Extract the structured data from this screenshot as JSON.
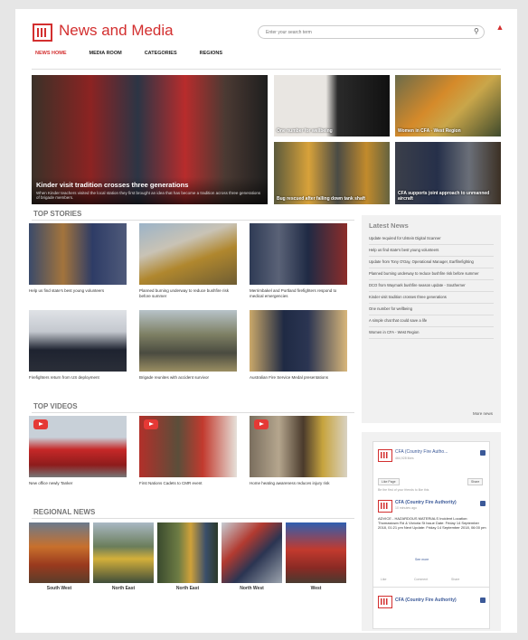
{
  "header": {
    "site_title": "News and Media",
    "search_placeholder": "Enter your search term",
    "nav": [
      "NEWS HOME",
      "MEDIA ROOM",
      "CATEGORIES",
      "REGIONS"
    ]
  },
  "hero": {
    "title": "Kinder visit tradition crosses three generations",
    "description": "When Kinder teachers visited the local station they first brought an idea that has become a tradition across three generations of brigade members."
  },
  "feature_tiles": [
    "One number for wellbeing",
    "Women in CFA - West Region",
    "Bug rescued after falling down tank shaft",
    "CFA supports joint approach to unmanned aircraft"
  ],
  "top_stories": {
    "title": "TOP STORIES",
    "items": [
      "Help us find state's best young volunteers",
      "Planned burning underway to reduce bushfire risk before summer",
      "Merrimbakel and Portland firefighters respond to medical emergencies",
      "Firefighters return from US deployment",
      "Brigade reunites with accident survivor",
      "Australian Fire Service Medal presentations"
    ]
  },
  "latest_news": {
    "title": "Latest News",
    "items": [
      "Update required for Ulstein Digital Scanner",
      "Help us find state's best young volunteers",
      "Update from Tony O'Day, Operational Manager, Earlfirefighting",
      "Planned burning underway to reduce bushfire risk before summer",
      "DCO from Waymark bushfire season update - Southerner",
      "Kinder visit tradition crosses three generations",
      "One number for wellbeing",
      "A simple chat that could save a life",
      "Women in CFA - West Region"
    ],
    "more": "More news"
  },
  "top_videos": {
    "title": "TOP VIDEOS",
    "items": [
      "New office newly Tanker",
      "First Nations Cadets to CMR event",
      "Home heating awareness reduces injury risk"
    ]
  },
  "facebook": {
    "page_name": "CFA (Country Fire Autho...",
    "likes": "464,928 likes",
    "like_page": "Like Page",
    "share": "Share",
    "friends": "Be the first of your friends to like this",
    "post_name": "CFA (Country Fire Authority)",
    "post_time": "10 minutes ago",
    "post_text": "ADVICE - HAZARDOUS MATERIALS Incident Location: Thomastown Rd & Victoria St Issue Date: Friday 14 September 2018, 01:21 pm Next Update: Friday 14 September 2018, 06:00 pm",
    "see_more": "See more",
    "actions": [
      "Like",
      "Comment",
      "Share"
    ],
    "post_name_2": "CFA (Country Fire Authority)"
  },
  "regional_news": {
    "title": "REGIONAL NEWS",
    "regions": [
      "South West",
      "North East",
      "North East",
      "North West",
      "West"
    ]
  }
}
